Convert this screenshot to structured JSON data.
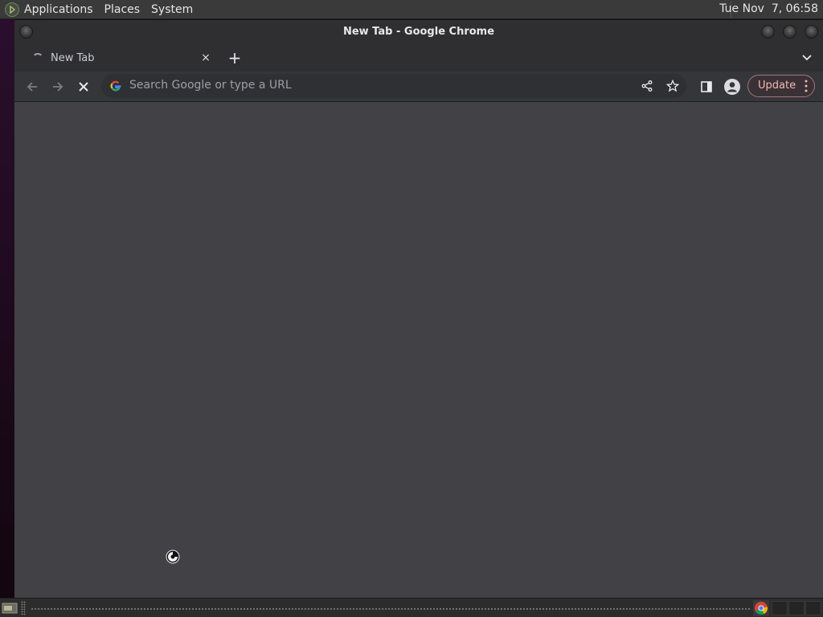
{
  "top_panel": {
    "menus": [
      "Applications",
      "Places",
      "System"
    ],
    "clock": "Tue Nov  7, 06:58"
  },
  "window": {
    "title": "New Tab - Google Chrome"
  },
  "tab": {
    "title": "New Tab",
    "close_glyph": "×",
    "new_tab_glyph": "+"
  },
  "toolbar": {
    "omnibox_placeholder": "Search Google or type a URL",
    "update_label": "Update"
  },
  "icons": {
    "menu_logo": "gnome-foot-icon",
    "tab_loading": "loading-spinner-icon",
    "back": "arrow-left-icon",
    "forward": "arrow-right-icon",
    "stop": "close-x-icon",
    "omnibox": "google-g-icon",
    "share": "share-icon",
    "bookmark": "star-icon",
    "side_panel": "side-panel-icon",
    "profile": "person-circle-icon",
    "more": "three-dots-vertical-icon",
    "tab_search": "chevron-down-icon",
    "cursor": "busy-cursor-icon",
    "taskbar_chrome": "chrome-logo-icon"
  },
  "colors": {
    "content_bg": "#424246",
    "toolbar_bg": "#35363a",
    "update_accent": "#f2b8b5"
  }
}
